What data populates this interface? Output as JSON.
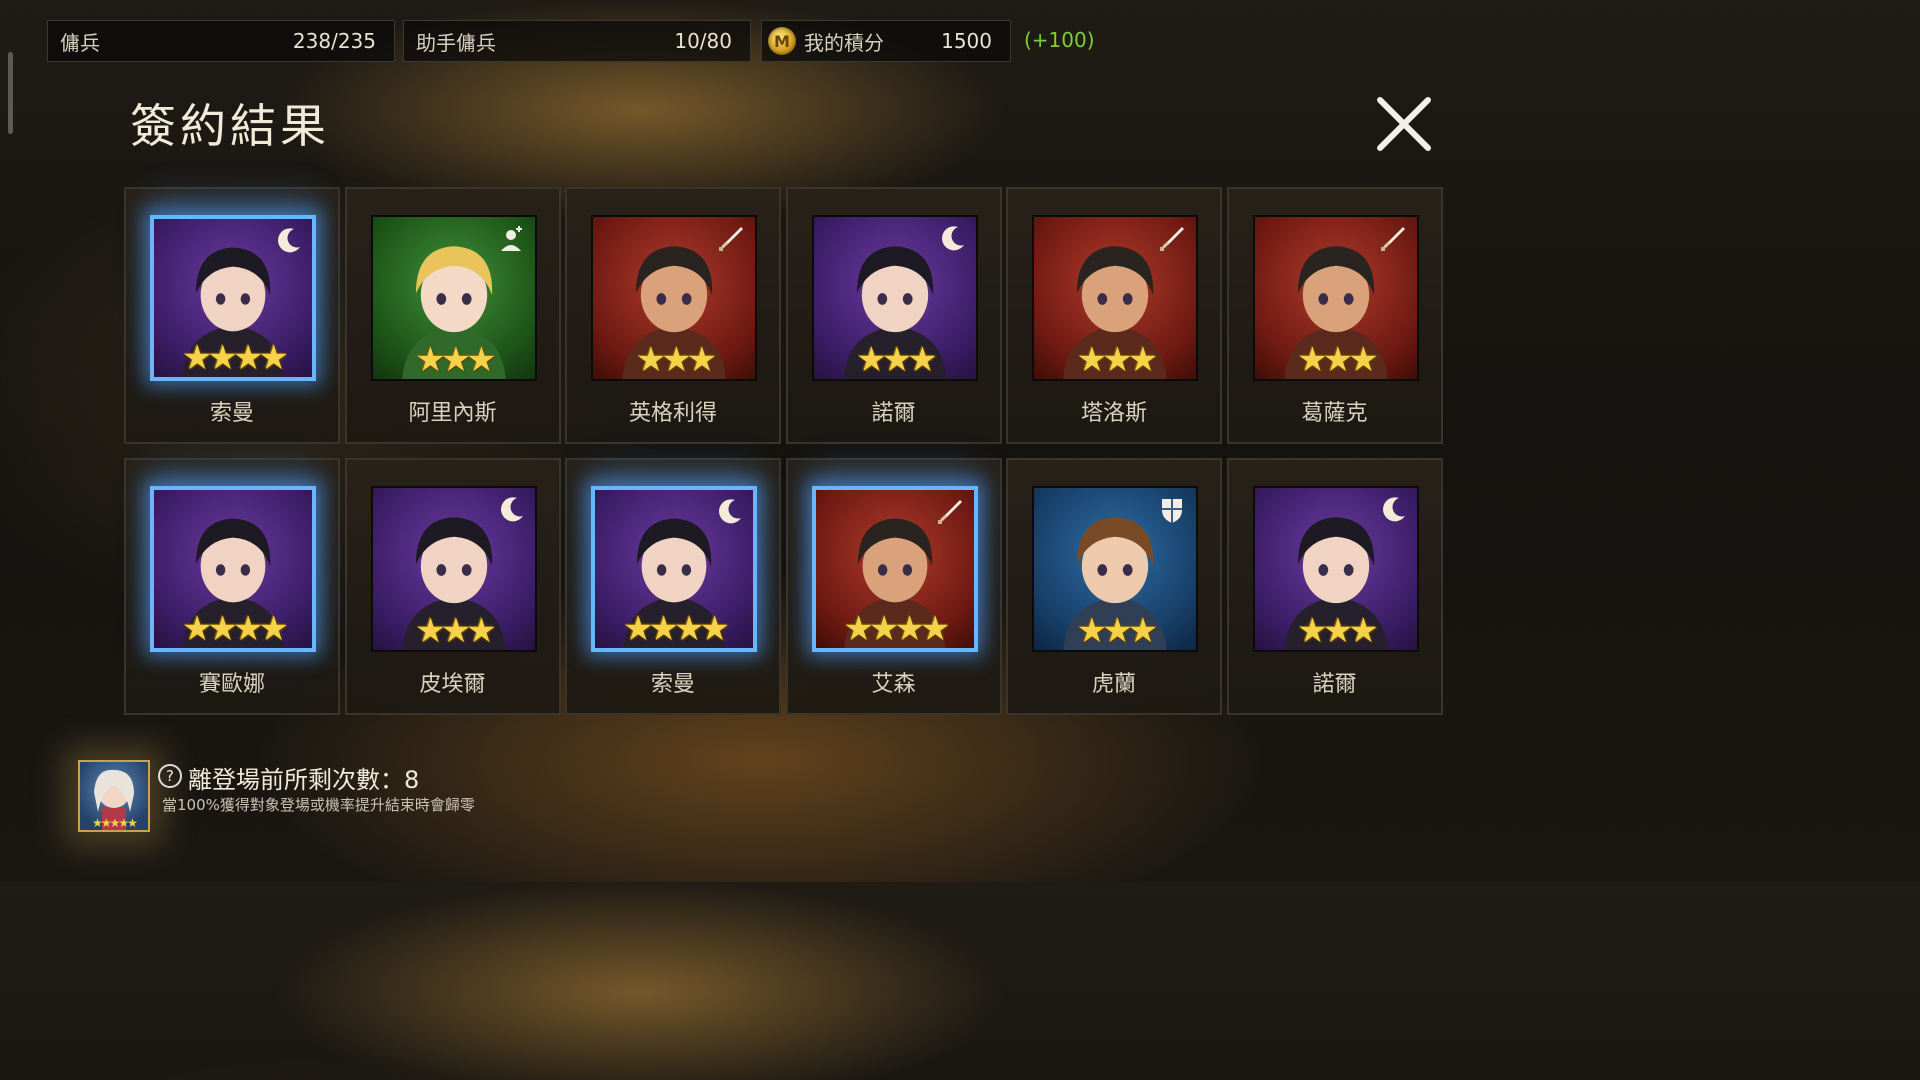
{
  "resources": [
    {
      "label": "傭兵",
      "value": "238/235"
    },
    {
      "label": "助手傭兵",
      "value": "10/80"
    },
    {
      "label": "我的積分",
      "value": "1500",
      "bonus": "(+100)",
      "coin_letter": "M"
    }
  ],
  "title": "簽約結果",
  "results": [
    {
      "name": "索曼",
      "stars": "★★★★",
      "bg": "purple",
      "type": "moon-icon",
      "selected": true
    },
    {
      "name": "阿里內斯",
      "stars": "★★★",
      "bg": "green",
      "type": "healer-icon",
      "selected": false
    },
    {
      "name": "英格利得",
      "stars": "★★★",
      "bg": "red",
      "type": "sword-icon",
      "selected": false
    },
    {
      "name": "諾爾",
      "stars": "★★★",
      "bg": "purple",
      "type": "moon-icon",
      "selected": false
    },
    {
      "name": "塔洛斯",
      "stars": "★★★",
      "bg": "red",
      "type": "sword-icon",
      "selected": false
    },
    {
      "name": "葛薩克",
      "stars": "★★★",
      "bg": "red",
      "type": "sword-icon",
      "selected": false
    },
    {
      "name": "賽歐娜",
      "stars": "★★★★",
      "bg": "purple",
      "type": "",
      "selected": true
    },
    {
      "name": "皮埃爾",
      "stars": "★★★",
      "bg": "purple",
      "type": "moon-icon",
      "selected": false
    },
    {
      "name": "索曼",
      "stars": "★★★★",
      "bg": "purple",
      "type": "moon-icon",
      "selected": true
    },
    {
      "name": "艾森",
      "stars": "★★★★",
      "bg": "red",
      "type": "sword-icon",
      "selected": true
    },
    {
      "name": "虎蘭",
      "stars": "★★★",
      "bg": "blue",
      "type": "shield-icon",
      "selected": false
    },
    {
      "name": "諾爾",
      "stars": "★★★",
      "bg": "purple",
      "type": "moon-icon",
      "selected": false
    }
  ],
  "pity": {
    "label": "離登場前所剩次數：8",
    "note": "當100%獲得對象登場或機率提升結束時會歸零",
    "stars": "★★★★★"
  }
}
